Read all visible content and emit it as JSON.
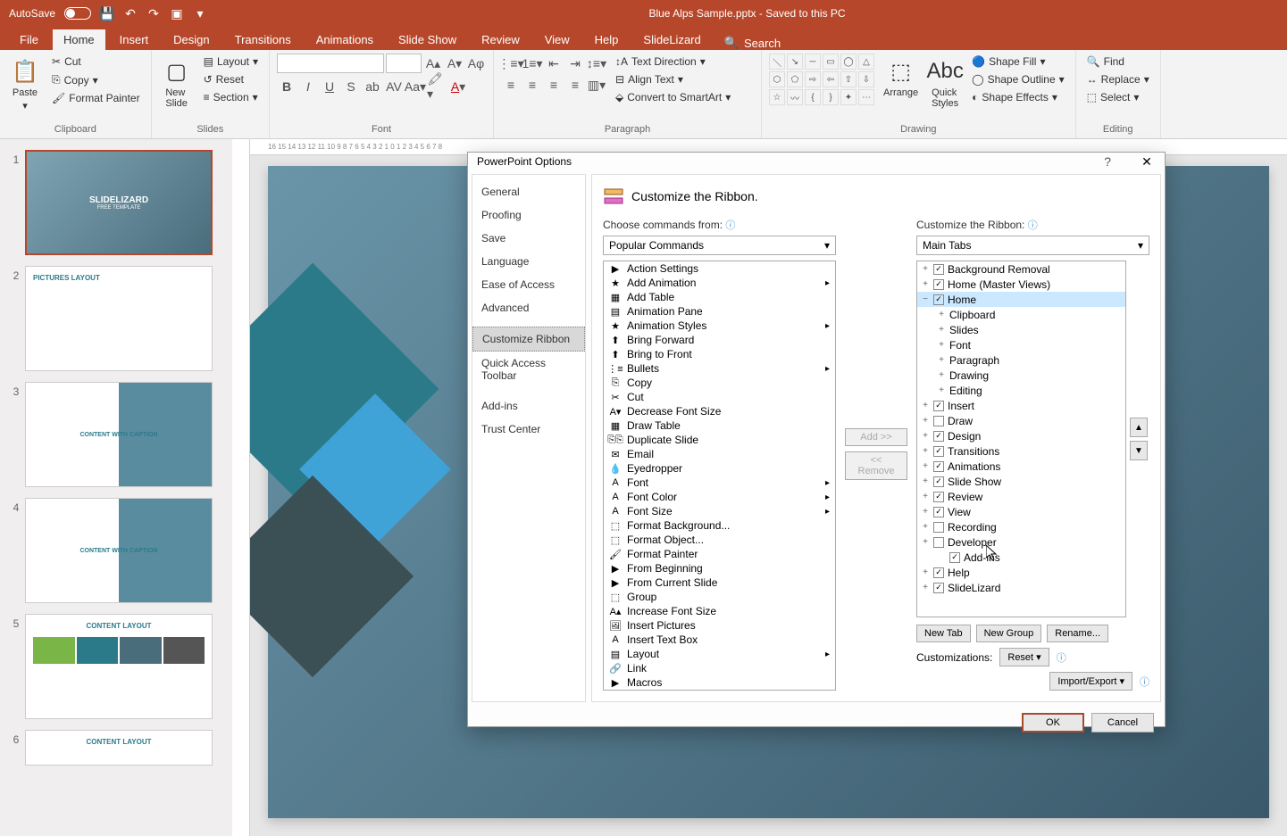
{
  "titlebar": {
    "autosave_label": "AutoSave",
    "document_title": "Blue Alps Sample.pptx - Saved to this PC"
  },
  "ribbon_tabs": [
    "File",
    "Home",
    "Insert",
    "Design",
    "Transitions",
    "Animations",
    "Slide Show",
    "Review",
    "View",
    "Help",
    "SlideLizard"
  ],
  "ribbon_tabs_active_index": 1,
  "search_placeholder": "Search",
  "ribbon": {
    "clipboard": {
      "label": "Clipboard",
      "paste": "Paste",
      "cut": "Cut",
      "copy": "Copy",
      "format_painter": "Format Painter"
    },
    "slides": {
      "label": "Slides",
      "new_slide": "New\nSlide",
      "layout": "Layout",
      "reset": "Reset",
      "section": "Section"
    },
    "font": {
      "label": "Font"
    },
    "paragraph": {
      "label": "Paragraph",
      "text_direction": "Text Direction",
      "align_text": "Align Text",
      "convert_smartart": "Convert to SmartArt"
    },
    "drawing": {
      "label": "Drawing",
      "arrange": "Arrange",
      "quick_styles": "Quick\nStyles",
      "shape_fill": "Shape Fill",
      "shape_outline": "Shape Outline",
      "shape_effects": "Shape Effects"
    },
    "editing": {
      "label": "Editing",
      "find": "Find",
      "replace": "Replace",
      "select": "Select"
    }
  },
  "slides": {
    "thumb1_title": "SLIDELIZARD",
    "thumb1_subtitle": "FREE TEMPLATE",
    "thumb2_title": "PICTURES LAYOUT",
    "thumb3_title": "CONTENT WITH CAPTION",
    "thumb4_title": "CONTENT WITH CAPTION",
    "thumb5_title": "CONTENT LAYOUT",
    "thumb6_title": "CONTENT LAYOUT"
  },
  "dialog": {
    "title": "PowerPoint Options",
    "sidebar": [
      "General",
      "Proofing",
      "Save",
      "Language",
      "Ease of Access",
      "Advanced",
      "Customize Ribbon",
      "Quick Access Toolbar",
      "Add-ins",
      "Trust Center"
    ],
    "sidebar_selected_index": 6,
    "heading": "Customize the Ribbon.",
    "choose_label": "Choose commands from:",
    "choose_value": "Popular Commands",
    "customize_label": "Customize the Ribbon:",
    "customize_value": "Main Tabs",
    "commands": [
      "Action Settings",
      "Add Animation",
      "Add Table",
      "Animation Pane",
      "Animation Styles",
      "Bring Forward",
      "Bring to Front",
      "Bullets",
      "Copy",
      "Cut",
      "Decrease Font Size",
      "Draw Table",
      "Duplicate Slide",
      "Email",
      "Eyedropper",
      "Font",
      "Font Color",
      "Font Size",
      "Format Background...",
      "Format Object...",
      "Format Painter",
      "From Beginning",
      "From Current Slide",
      "Group",
      "Increase Font Size",
      "Insert Pictures",
      "Insert Text Box",
      "Layout",
      "Link",
      "Macros"
    ],
    "commands_with_submenu": [
      1,
      4,
      7,
      15,
      16,
      17,
      27
    ],
    "tree": [
      {
        "level": 0,
        "expand": "+",
        "checked": true,
        "label": "Background Removal"
      },
      {
        "level": 0,
        "expand": "+",
        "checked": true,
        "label": "Home (Master Views)"
      },
      {
        "level": 0,
        "expand": "−",
        "checked": true,
        "label": "Home",
        "selected": true
      },
      {
        "level": 1,
        "expand": "+",
        "label": "Clipboard"
      },
      {
        "level": 1,
        "expand": "+",
        "label": "Slides"
      },
      {
        "level": 1,
        "expand": "+",
        "label": "Font"
      },
      {
        "level": 1,
        "expand": "+",
        "label": "Paragraph"
      },
      {
        "level": 1,
        "expand": "+",
        "label": "Drawing"
      },
      {
        "level": 1,
        "expand": "+",
        "label": "Editing"
      },
      {
        "level": 0,
        "expand": "+",
        "checked": true,
        "label": "Insert"
      },
      {
        "level": 0,
        "expand": "+",
        "checked": false,
        "label": "Draw"
      },
      {
        "level": 0,
        "expand": "+",
        "checked": true,
        "label": "Design"
      },
      {
        "level": 0,
        "expand": "+",
        "checked": true,
        "label": "Transitions"
      },
      {
        "level": 0,
        "expand": "+",
        "checked": true,
        "label": "Animations"
      },
      {
        "level": 0,
        "expand": "+",
        "checked": true,
        "label": "Slide Show"
      },
      {
        "level": 0,
        "expand": "+",
        "checked": true,
        "label": "Review"
      },
      {
        "level": 0,
        "expand": "+",
        "checked": true,
        "label": "View"
      },
      {
        "level": 0,
        "expand": "+",
        "checked": false,
        "label": "Recording"
      },
      {
        "level": 0,
        "expand": "+",
        "checked": false,
        "label": "Developer"
      },
      {
        "level": 1,
        "expand": "",
        "checked": true,
        "label": "Add-ins"
      },
      {
        "level": 0,
        "expand": "+",
        "checked": true,
        "label": "Help"
      },
      {
        "level": 0,
        "expand": "+",
        "checked": true,
        "label": "SlideLizard"
      }
    ],
    "add_btn": "Add >>",
    "remove_btn": "<< Remove",
    "new_tab": "New Tab",
    "new_group": "New Group",
    "rename": "Rename...",
    "customizations_label": "Customizations:",
    "reset": "Reset",
    "import_export": "Import/Export",
    "ok": "OK",
    "cancel": "Cancel"
  },
  "ruler_marks": "16   15   14   13   12   11   10    9    8    7    6    5    4    3    2    1    0    1    2    3    4    5    6    7    8"
}
